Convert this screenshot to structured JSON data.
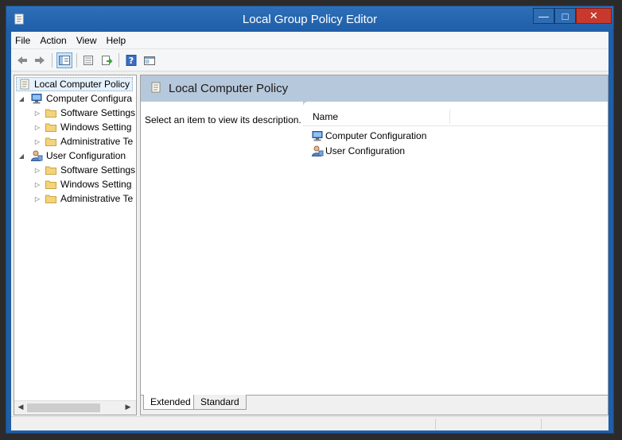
{
  "window": {
    "title": "Local Group Policy Editor",
    "minimize_glyph": "—",
    "maximize_glyph": "□",
    "close_glyph": "✕"
  },
  "menu": [
    "File",
    "Action",
    "View",
    "Help"
  ],
  "toolbar": {
    "back_icon": "back-arrow-icon",
    "forward_icon": "forward-arrow-icon",
    "show_hide_tree_icon": "console-tree-icon",
    "properties_icon": "properties-icon",
    "export_icon": "export-list-icon",
    "help_icon": "help-icon",
    "mmc_icon": "mmc-view-icon"
  },
  "tree": {
    "root": "Local Computer Policy",
    "computer": {
      "label": "Computer Configura",
      "children": [
        "Software Settings",
        "Windows Setting",
        "Administrative Te"
      ]
    },
    "user": {
      "label": "User Configuration",
      "children": [
        "Software Settings",
        "Windows Setting",
        "Administrative Te"
      ]
    }
  },
  "right": {
    "title": "Local Computer Policy",
    "description": "Select an item to view its description.",
    "column_name": "Name",
    "items": [
      "Computer Configuration",
      "User Configuration"
    ]
  },
  "tabs": [
    "Extended",
    "Standard"
  ],
  "colors": {
    "titlebar": "#1f5ea8",
    "close_button": "#c7392d",
    "header_band": "#b6c8db"
  }
}
